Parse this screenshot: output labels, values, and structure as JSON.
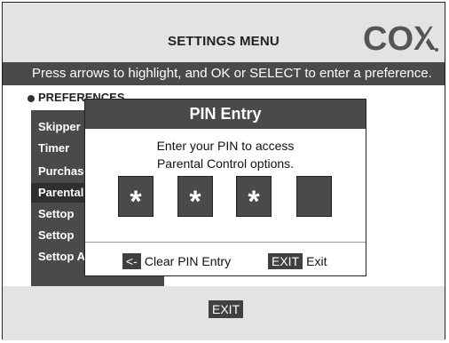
{
  "header": {
    "title": "SETTINGS MENU",
    "logo": "COX"
  },
  "instructions": "Press arrows to highlight, and OK or SELECT to enter a preference.",
  "preferences": {
    "label": "PREFERENCES",
    "items": [
      {
        "label": "Skipper"
      },
      {
        "label": "Timer"
      },
      {
        "label": "Purchase"
      },
      {
        "label": "Parental"
      },
      {
        "label": "Settop"
      },
      {
        "label": "Settop"
      },
      {
        "label": "Settop AC Outlet"
      }
    ],
    "highlighted_index": 3
  },
  "pin_dialog": {
    "title": "PIN Entry",
    "message_line1": "Enter your PIN to access",
    "message_line2": "Parental Control options.",
    "digits": [
      "*",
      "*",
      "*",
      ""
    ],
    "clear_key": "<-",
    "clear_label": "Clear PIN Entry",
    "exit_key": "EXIT",
    "exit_label": "Exit"
  },
  "footer": {
    "exit_label": "EXIT"
  },
  "colors": {
    "dark_gray": "#4a4a4a",
    "light_gray": "#e3e3e3",
    "white": "#ffffff"
  }
}
